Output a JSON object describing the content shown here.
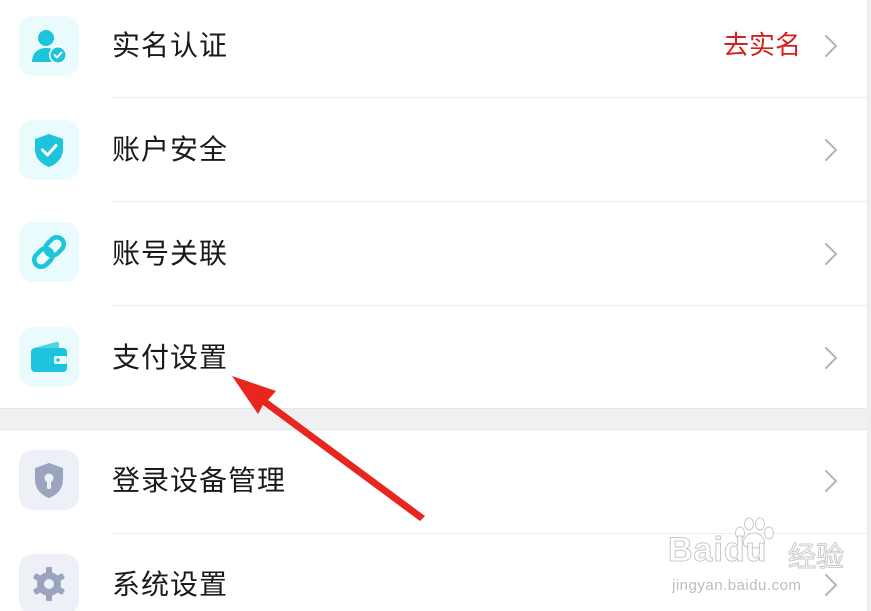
{
  "settings_group_1": {
    "items": [
      {
        "label": "实名认证",
        "status": "去实名",
        "icon": "verified-user-icon"
      },
      {
        "label": "账户安全",
        "icon": "shield-check-icon"
      },
      {
        "label": "账号关联",
        "icon": "link-icon"
      },
      {
        "label": "支付设置",
        "icon": "wallet-icon"
      }
    ]
  },
  "settings_group_2": {
    "items": [
      {
        "label": "登录设备管理",
        "icon": "lock-shield-icon"
      },
      {
        "label": "系统设置",
        "icon": "gear-icon"
      }
    ]
  },
  "colors": {
    "accent_cyan": "#1ec4dc",
    "icon_tile_cyan": "#e9fbfd",
    "icon_gray": "#9aa5bd",
    "status_red": "#d6201b",
    "annotation_arrow": "#e8251f"
  },
  "annotation": {
    "type": "arrow",
    "points_to": "支付设置"
  },
  "watermark": {
    "brand": "Baidu",
    "brand_cn": "经验",
    "url": "jingyan.baidu.com"
  }
}
